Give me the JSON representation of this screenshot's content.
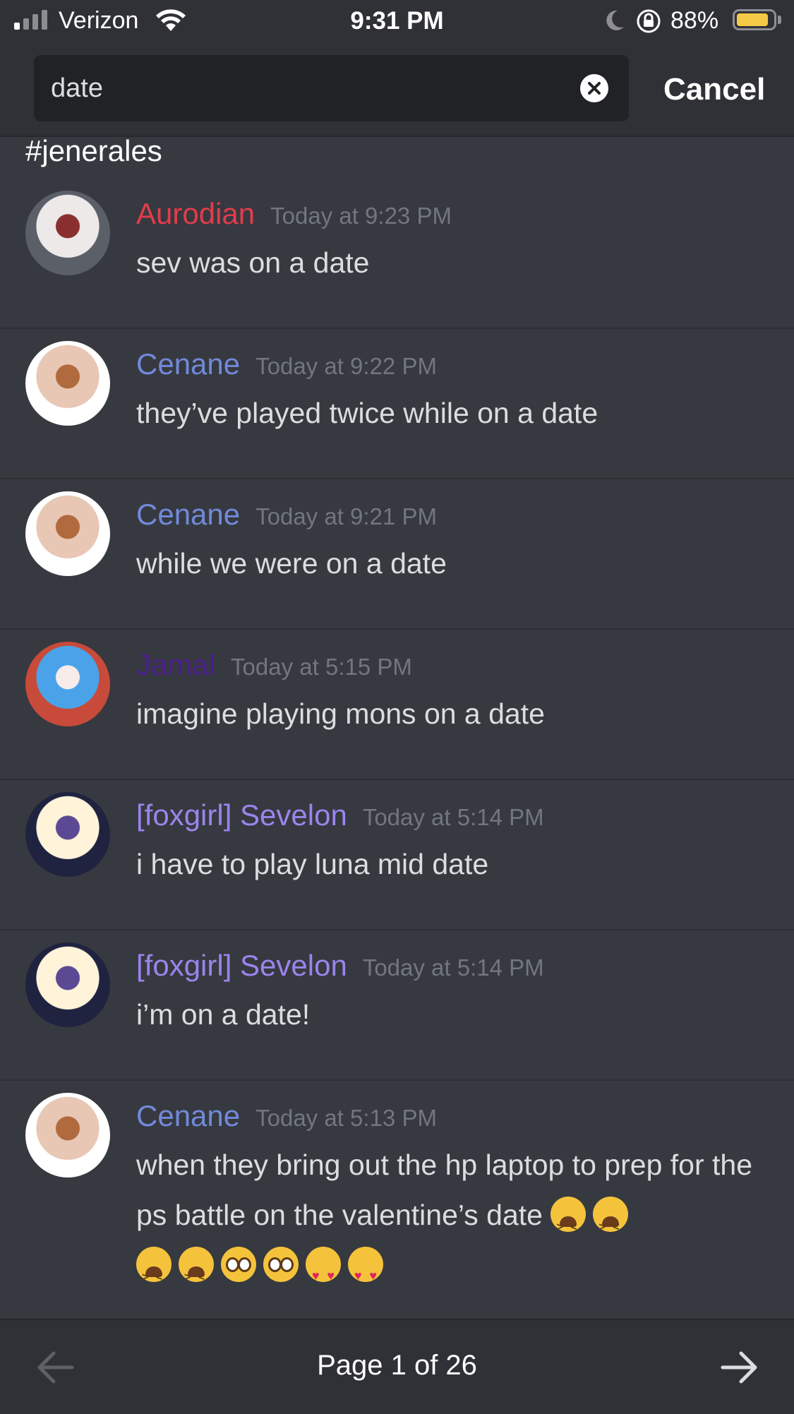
{
  "status_bar": {
    "carrier": "Verizon",
    "time": "9:31 PM",
    "battery_pct": "88%",
    "battery_level": 0.88,
    "icons": [
      "signal-icon",
      "wifi-icon",
      "moon-icon",
      "rotation-lock-icon",
      "battery-icon"
    ]
  },
  "search": {
    "query": "date",
    "cancel_label": "Cancel"
  },
  "channel": "#jenerales",
  "messages": [
    {
      "author": "Aurodian",
      "author_color": "#e23c4c",
      "timestamp": "Today at 9:23 PM",
      "text": "sev was on a date",
      "avatar_colors": [
        "#ede9e9",
        "#8a2f2f",
        "#5a5f68"
      ]
    },
    {
      "author": "Cenane",
      "author_color": "#7289da",
      "timestamp": "Today at 9:22 PM",
      "text": "they’ve played twice while on a date",
      "avatar_colors": [
        "#e8c7b5",
        "#b06a3d",
        "#ffffff"
      ]
    },
    {
      "author": "Cenane",
      "author_color": "#7289da",
      "timestamp": "Today at 9:21 PM",
      "text": "while we were on a date",
      "avatar_colors": [
        "#e8c7b5",
        "#b06a3d",
        "#ffffff"
      ]
    },
    {
      "author": "Jamal",
      "author_color": "#4a1f8a",
      "timestamp": "Today at 5:15 PM",
      "text": "imagine playing mons on a date",
      "avatar_colors": [
        "#4aa3e8",
        "#f7ecea",
        "#c84a3a"
      ]
    },
    {
      "author": "[foxgirl] Sevelon",
      "author_color": "#9b84ec",
      "timestamp": "Today at 5:14 PM",
      "text": "i have to play luna mid date",
      "avatar_colors": [
        "#fff3da",
        "#5b4a93",
        "#1f2340"
      ]
    },
    {
      "author": "[foxgirl] Sevelon",
      "author_color": "#9b84ec",
      "timestamp": "Today at 5:14 PM",
      "text": "i’m on a date!",
      "avatar_colors": [
        "#fff3da",
        "#5b4a93",
        "#1f2340"
      ]
    },
    {
      "author": "Cenane",
      "author_color": "#7289da",
      "timestamp": "Today at 5:13 PM",
      "text": "when they bring out the hp laptop to prep for the ps battle on the valentine’s date",
      "avatar_colors": [
        "#e8c7b5",
        "#b06a3d",
        "#ffffff"
      ],
      "emojis": [
        "weary",
        "weary",
        "weary",
        "weary",
        "pleading",
        "pleading",
        "heart-eyes",
        "heart-eyes"
      ]
    }
  ],
  "pager": {
    "label": "Page 1 of 26",
    "prev_icon": "arrow-left-icon",
    "next_icon": "arrow-right-icon"
  }
}
